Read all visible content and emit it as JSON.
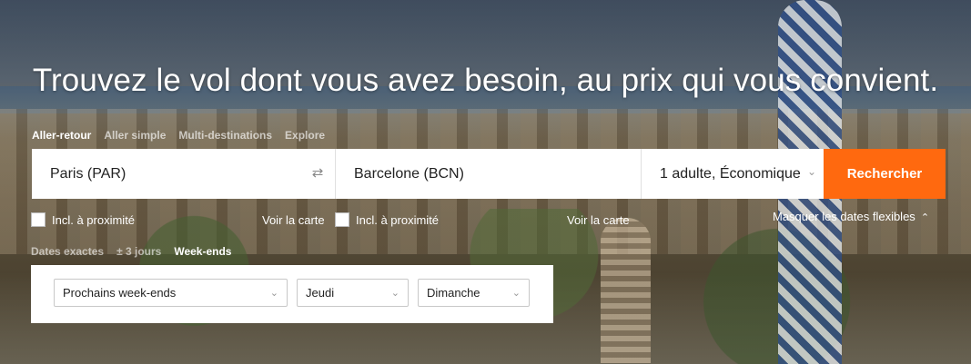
{
  "headline": "Trouvez le vol dont vous avez besoin, au prix qui vous convient.",
  "trip_types": [
    {
      "label": "Aller-retour",
      "active": true
    },
    {
      "label": "Aller simple",
      "active": false
    },
    {
      "label": "Multi-destinations",
      "active": false
    },
    {
      "label": "Explore",
      "active": false
    }
  ],
  "search": {
    "origin": "Paris (PAR)",
    "destination": "Barcelone (BCN)",
    "travelers": "1 adulte, Économique",
    "submit_label": "Rechercher"
  },
  "options": {
    "origin_nearby": "Incl. à proximité",
    "origin_map": "Voir la carte",
    "dest_nearby": "Incl. à proximité",
    "dest_map": "Voir la carte",
    "flex_toggle": "Masquer les dates flexibles"
  },
  "date_modes": [
    {
      "label": "Dates exactes",
      "active": false
    },
    {
      "label": "± 3 jours",
      "active": false
    },
    {
      "label": "Week-ends",
      "active": true
    }
  ],
  "flex": {
    "weekends": "Prochains week-ends",
    "depart_day": "Jeudi",
    "return_day": "Dimanche"
  },
  "colors": {
    "accent": "#ff690f"
  }
}
